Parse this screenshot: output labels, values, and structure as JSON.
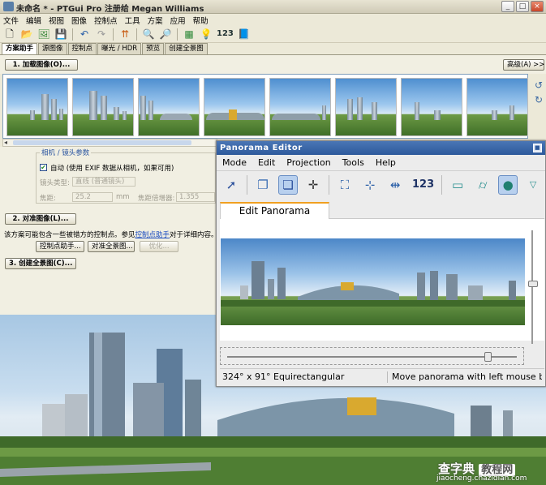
{
  "window": {
    "title": "未命名 * - PTGui Pro 注册给 Megan Williams",
    "min": "_",
    "max": "□",
    "close": "×"
  },
  "menu": [
    "文件",
    "编辑",
    "视图",
    "图像",
    "控制点",
    "工具",
    "方案",
    "应用",
    "帮助"
  ],
  "toolbar": {
    "count_label": "123"
  },
  "tabs": [
    "方案助手",
    "源图像",
    "控制点",
    "曝光 / HDR",
    "预览",
    "创建全景图"
  ],
  "load_button": "1. 加载图像(O)...",
  "advanced_button": "高级(A) >>",
  "thumbnail_count": 8,
  "camera": {
    "group_title": "相机 / 镜头参数",
    "auto_checked": true,
    "auto_label": "自动 (使用 EXIF 数据从相机，如果可用)",
    "lens_type_label": "镜头类型:",
    "lens_type_value": "直线 (普通镜头)",
    "focal_label": "焦距:",
    "focal_value": "25.2",
    "focal_unit": "mm",
    "multiplier_label": "焦距倍增器:",
    "multiplier_value": "1.355"
  },
  "align_button": "2. 对准图像(L)...",
  "note": {
    "before": "该方案可能包含一些被错方的控制点。参见",
    "link": "控制点助手",
    "after": "对于详细内容。"
  },
  "cp_assistant_button": "控制点助手...",
  "align_to_pano_button": "对准全景图...",
  "optimize_button": "优化...",
  "create_button": "3. 创建全景图(C)...",
  "panorama_editor": {
    "title": "Panorama Editor",
    "menu": [
      "Mode",
      "Edit",
      "Projection",
      "Tools",
      "Help"
    ],
    "toolbar_number": "123",
    "tab": "Edit Panorama",
    "status_left": "324° x 91° Equirectangular",
    "status_right": "Move panorama with left mouse bu",
    "horizontal_slider": 0.9,
    "vertical_slider": 0.5
  },
  "watermark": {
    "line1a": "查字典",
    "line1b": "教程网",
    "line2": "jiaocheng.chazidian.com"
  }
}
